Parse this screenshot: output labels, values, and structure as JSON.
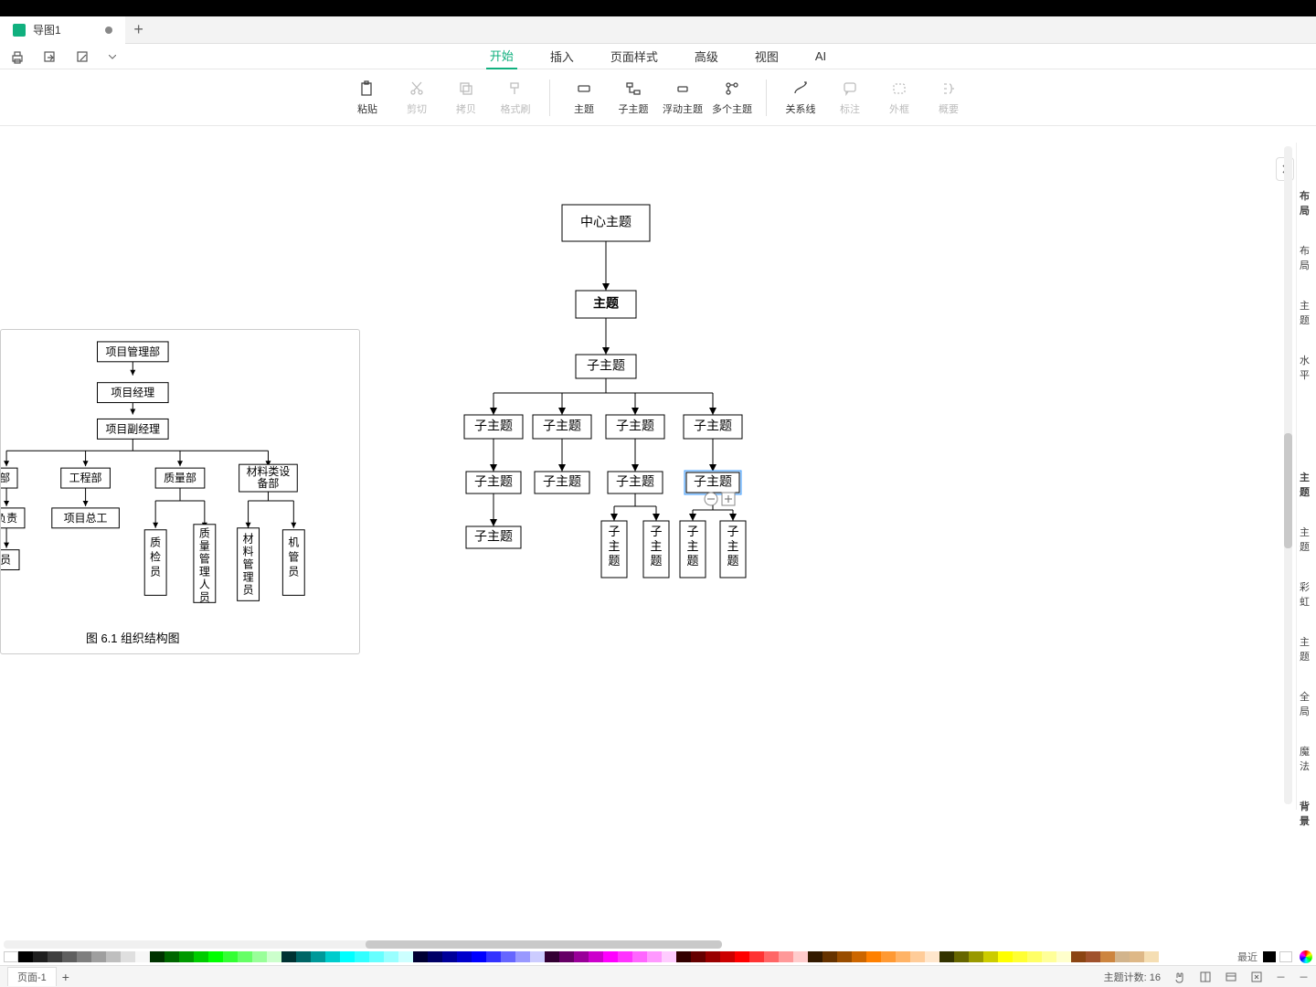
{
  "tab": {
    "title": "导图1"
  },
  "menus": {
    "start": "开始",
    "insert": "插入",
    "page_style": "页面样式",
    "advanced": "高级",
    "view": "视图",
    "ai": "AI"
  },
  "ribbon": {
    "paste": "粘贴",
    "cut": "剪切",
    "copy": "拷贝",
    "format_painter": "格式刷",
    "topic": "主题",
    "subtopic": "子主题",
    "floating": "浮动主题",
    "multi": "多个主题",
    "relation": "关系线",
    "note": "标注",
    "boundary": "外框",
    "summary": "概要"
  },
  "mindmap": {
    "root": "中心主题",
    "l1": "主题",
    "l2": "子主题",
    "l3": [
      "子主题",
      "子主题",
      "子主题",
      "子主题"
    ],
    "l4": [
      "子主题",
      "子主题",
      "子主题",
      "子主题"
    ],
    "l5_0": "子主题",
    "l5_2": [
      "子",
      "主",
      "题",
      "子",
      "主",
      "题"
    ],
    "l5_3": [
      "子",
      "主",
      "题",
      "子",
      "主",
      "题"
    ]
  },
  "embedded": {
    "n1": "项目管理部",
    "n2": "项目经理",
    "n3": "项目副经理",
    "r1a": "部",
    "r1b": "工程部",
    "r1c": "质量部",
    "r1d": "材料类设\n备部",
    "r2a": "负责",
    "r2b": "项目总工",
    "r3a": "员",
    "r3c1": "质\n检\n员",
    "r3c2": "质\n量\n管\n理\n人\n员",
    "r3d1": "材\n料\n管\n理\n员",
    "r3d2": "机\n管\n员",
    "caption": "图 6.1  组织结构图"
  },
  "side": {
    "section1": "布局",
    "layout": "布局",
    "theme": "主题",
    "horizontal": "水平",
    "section2": "主题",
    "theme2": "主题",
    "rainbow": "彩虹",
    "theme3": "主题",
    "global": "全局",
    "magic": "魔法",
    "bg": "背景"
  },
  "colorstrip": {
    "recent_label": "最近",
    "colors": [
      "#ffffff",
      "#000000",
      "#1f1f1f",
      "#3f3f3f",
      "#5f5f5f",
      "#7f7f7f",
      "#9f9f9f",
      "#bfbfbf",
      "#dfdfdf",
      "#f7f7f7",
      "#003300",
      "#006600",
      "#009900",
      "#00cc00",
      "#00ff00",
      "#33ff33",
      "#66ff66",
      "#99ff99",
      "#ccffcc",
      "#003333",
      "#006666",
      "#009999",
      "#00cccc",
      "#00ffff",
      "#33ffff",
      "#66ffff",
      "#99ffff",
      "#ccffff",
      "#000033",
      "#000066",
      "#000099",
      "#0000cc",
      "#0000ff",
      "#3333ff",
      "#6666ff",
      "#9999ff",
      "#ccccff",
      "#330033",
      "#660066",
      "#990099",
      "#cc00cc",
      "#ff00ff",
      "#ff33ff",
      "#ff66ff",
      "#ff99ff",
      "#ffccff",
      "#330000",
      "#660000",
      "#990000",
      "#cc0000",
      "#ff0000",
      "#ff3333",
      "#ff6666",
      "#ff9999",
      "#ffcccc",
      "#331a00",
      "#663300",
      "#994d00",
      "#cc6600",
      "#ff8000",
      "#ff9933",
      "#ffb366",
      "#ffcc99",
      "#ffe6cc",
      "#333300",
      "#666600",
      "#999900",
      "#cccc00",
      "#ffff00",
      "#ffff33",
      "#ffff66",
      "#ffff99",
      "#ffffcc",
      "#8b4513",
      "#a0522d",
      "#cd853f",
      "#d2b48c",
      "#deb887",
      "#f5deb3"
    ],
    "recent": [
      "#000000",
      "#ffffff"
    ]
  },
  "status": {
    "page": "页面-1",
    "topic_count_label": "主题计数:",
    "topic_count": "16"
  }
}
